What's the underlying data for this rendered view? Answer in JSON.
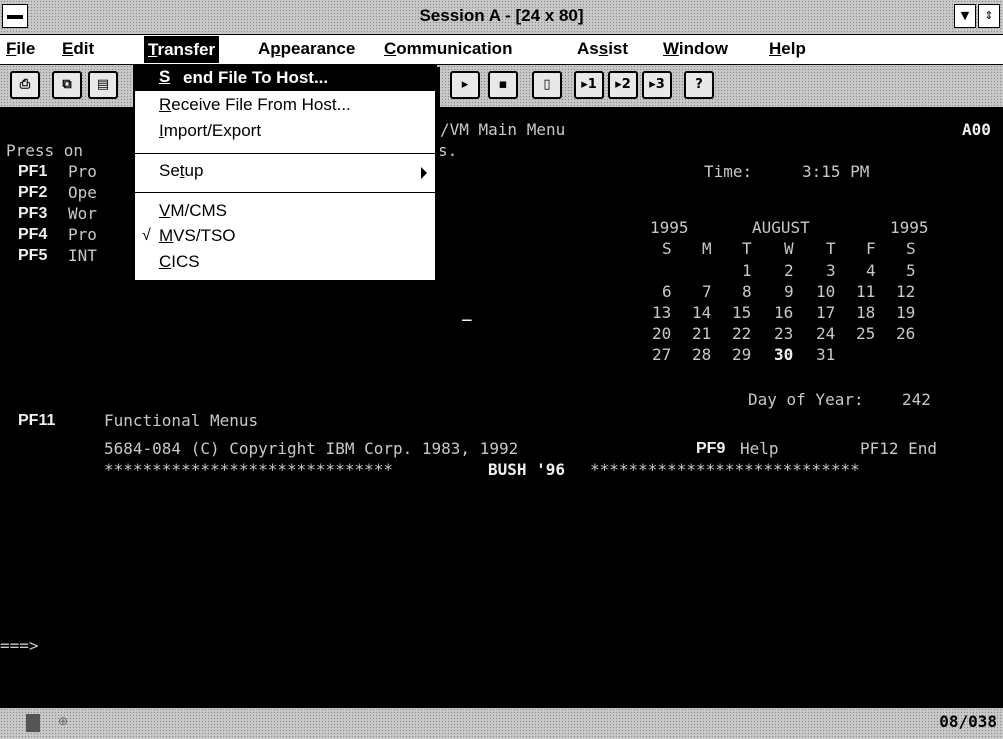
{
  "window": {
    "title": "Session A - [24 x 80]"
  },
  "menubar": {
    "items": [
      {
        "pre": "",
        "u": "F",
        "post": "ile"
      },
      {
        "pre": "",
        "u": "E",
        "post": "dit"
      },
      {
        "pre": "",
        "u": "T",
        "post": "ransfer"
      },
      {
        "pre": "A",
        "u": "p",
        "post": "pearance"
      },
      {
        "pre": "",
        "u": "C",
        "post": "ommunication"
      },
      {
        "pre": "As",
        "u": "s",
        "post": "ist"
      },
      {
        "pre": "",
        "u": "W",
        "post": "indow"
      },
      {
        "pre": "",
        "u": "H",
        "post": "elp"
      }
    ]
  },
  "dropdown": {
    "items": [
      {
        "pre": "",
        "u": "S",
        "post": "end File To Host...",
        "checked": false
      },
      {
        "pre": "",
        "u": "R",
        "post": "eceive File From Host...",
        "checked": false
      },
      {
        "pre": "",
        "u": "I",
        "post": "mport/Export",
        "checked": false
      },
      {
        "pre": "Se",
        "u": "t",
        "post": "up",
        "checked": false,
        "submenu": true
      },
      {
        "pre": "",
        "u": "V",
        "post": "M/CMS",
        "checked": false
      },
      {
        "pre": "",
        "u": "M",
        "post": "VS/TSO",
        "checked": true,
        "check_mark": "√"
      },
      {
        "pre": "",
        "u": "C",
        "post": "ICS",
        "checked": false
      }
    ]
  },
  "toolbar": {
    "icons": [
      "print-icon",
      "copy-icon",
      "paste-icon",
      "send-icon",
      "receive-icon",
      "clipboard-icon",
      "macro-1-icon",
      "macro-2-icon",
      "macro-3-icon",
      "help-icon"
    ],
    "labels": [
      "⎙",
      "⧉",
      "▤",
      "▸",
      "▪",
      "▯",
      "▸1",
      "▸2",
      "▸3",
      "?"
    ]
  },
  "terminal": {
    "title_fragment": "/VM Main Menu",
    "id": "A00",
    "press": "Press on",
    "press_tail": "s.",
    "pf_rows": [
      {
        "key": "PF1",
        "text": "Pro"
      },
      {
        "key": "PF2",
        "text": "Ope"
      },
      {
        "key": "PF3",
        "text": "Wor"
      },
      {
        "key": "PF4",
        "text": "Pro"
      },
      {
        "key": "PF5",
        "text": "INT"
      }
    ],
    "time_label": "Time:",
    "time_value": "3:15 PM",
    "calendar": {
      "year_left": "1995",
      "month": "AUGUST",
      "year_right": "1995",
      "weekdays": [
        "S",
        "M",
        "T",
        "W",
        "T",
        "F",
        "S"
      ],
      "weeks": [
        [
          "",
          "",
          "1",
          "2",
          "3",
          "4",
          "5"
        ],
        [
          "6",
          "7",
          "8",
          "9",
          "10",
          "11",
          "12"
        ],
        [
          "13",
          "14",
          "15",
          "16",
          "17",
          "18",
          "19"
        ],
        [
          "20",
          "21",
          "22",
          "23",
          "24",
          "25",
          "26"
        ],
        [
          "27",
          "28",
          "29",
          "30",
          "31",
          "",
          ""
        ]
      ],
      "today": "30",
      "day_of_year_label": "Day of Year:",
      "day_of_year": "242"
    },
    "cursor": "_",
    "pf11_key": "PF11",
    "pf11_text": "Functional Menus",
    "copyright": "5684-084 (C) Copyright IBM Corp. 1983, 1992",
    "pf9_key": "PF9",
    "pf9_text": "Help",
    "pf12": "PF12 End",
    "banner_left": "******************************",
    "banner_text": "BUSH '96",
    "banner_right": "****************************",
    "prompt": "===>"
  },
  "status": {
    "position": "08/038"
  }
}
